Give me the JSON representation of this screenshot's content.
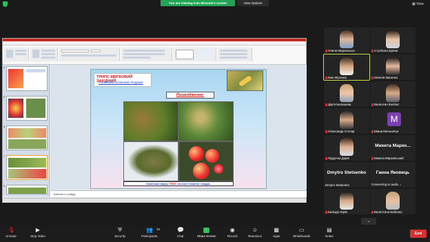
{
  "banner": {
    "viewing": "You are viewing Ivan Mironuk's screen",
    "view_options": "View Options",
    "view": "View"
  },
  "slide": {
    "title": "ТРИПС КВІТКОВИЙ ЗАХІДНИЙ",
    "subtitle": "Frankliniella occidentalis Pergande",
    "damage_heading": "Пошкодження:",
    "caption_before": "Симптоми вірусу ",
    "caption_virus": "TSWV",
    "caption_after": " на листі томатів і плодах."
  },
  "notes_text": "Заметки к слайду",
  "participants": [
    {
      "name": "Олена Марковська",
      "muted": true
    },
    {
      "name": "Стулієнко Бувіна",
      "muted": true
    },
    {
      "name": "Іван Міронюк",
      "muted": true,
      "active": true
    },
    {
      "name": "Євгенія Іваненко",
      "muted": true
    },
    {
      "name": "Дар'я Балишева",
      "muted": true
    },
    {
      "name": "Валентин Каліпат",
      "muted": true
    },
    {
      "name": "Олександр Степар",
      "muted": true
    },
    {
      "name": "Миша Мельничук",
      "muted": true,
      "initial": "M"
    },
    {
      "name": "Підручна Дарія",
      "muted": true,
      "big": "Микита Марко..."
    },
    {
      "name": "Микита Марковський",
      "muted": true
    },
    {
      "name": "Dmytro Stetsenko",
      "muted": false,
      "big": "Dmytro Stetsenko"
    },
    {
      "name": "Connecting to audio",
      "muted": false,
      "big": "Ганна Яковець"
    },
    {
      "name": "Каліщук Юрій",
      "muted": true
    },
    {
      "name": "Валентина Бабенко",
      "muted": true
    }
  ],
  "toolbar": {
    "unmute": "Unmute",
    "stop_video": "Stop Video",
    "security": "Security",
    "participants": "Participants",
    "participants_count": "15",
    "chat": "Chat",
    "share_screen": "Share Screen",
    "record": "Record",
    "reactions": "Reactions",
    "apps": "Apps",
    "whiteboards": "Whiteboards",
    "notes": "Notes",
    "end": "End"
  },
  "colors": {
    "share_green": "#2fbd58",
    "end_red": "#d63232",
    "active_outline": "#c6e14a",
    "slide_title_red": "#dd1111",
    "slide_blue": "#1a3fd1"
  },
  "icons": [
    "shield-icon",
    "mic-muted-icon",
    "video-icon",
    "security-icon",
    "participants-icon",
    "chat-icon",
    "share-screen-icon",
    "record-icon",
    "reactions-icon",
    "apps-icon",
    "whiteboards-icon",
    "notes-icon",
    "chevron-down-icon"
  ]
}
